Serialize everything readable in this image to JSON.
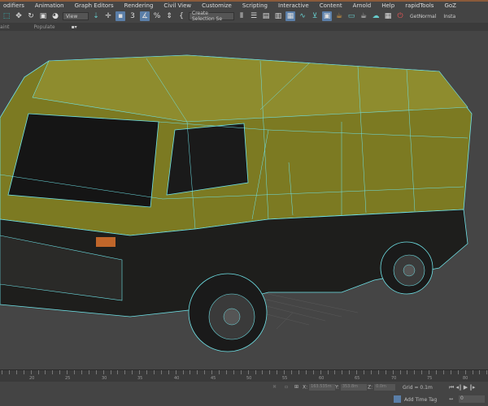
{
  "menu": [
    "odifiers",
    "Animation",
    "Graph Editors",
    "Rendering",
    "Civil View",
    "Customize",
    "Scripting",
    "Interactive",
    "Content",
    "Arnold",
    "Help",
    "rapidTools",
    "GoZ"
  ],
  "toolbar": {
    "view_dropdown": "View",
    "selection_set": "Create Selection Se",
    "get_normal": "GetNormal",
    "insta": "Insta"
  },
  "subbar": {
    "paint": "aint",
    "populate": "Populate"
  },
  "timeline": {
    "labels": [
      "20",
      "25",
      "30",
      "35",
      "40",
      "45",
      "50",
      "55",
      "60",
      "65",
      "70",
      "75",
      "80"
    ]
  },
  "status": {
    "x_label": "X:",
    "x_value": "163.535m",
    "y_label": "Y:",
    "y_value": "353.8m",
    "z_label": "Z:",
    "z_value": "0.0m",
    "grid": "Grid = 0.1m",
    "add_time_tag": "Add Time Tag",
    "frame": "0"
  },
  "colors": {
    "wire": "#6fe3e8",
    "paint": "#7c7a22",
    "accent": "#5a7ea8"
  }
}
